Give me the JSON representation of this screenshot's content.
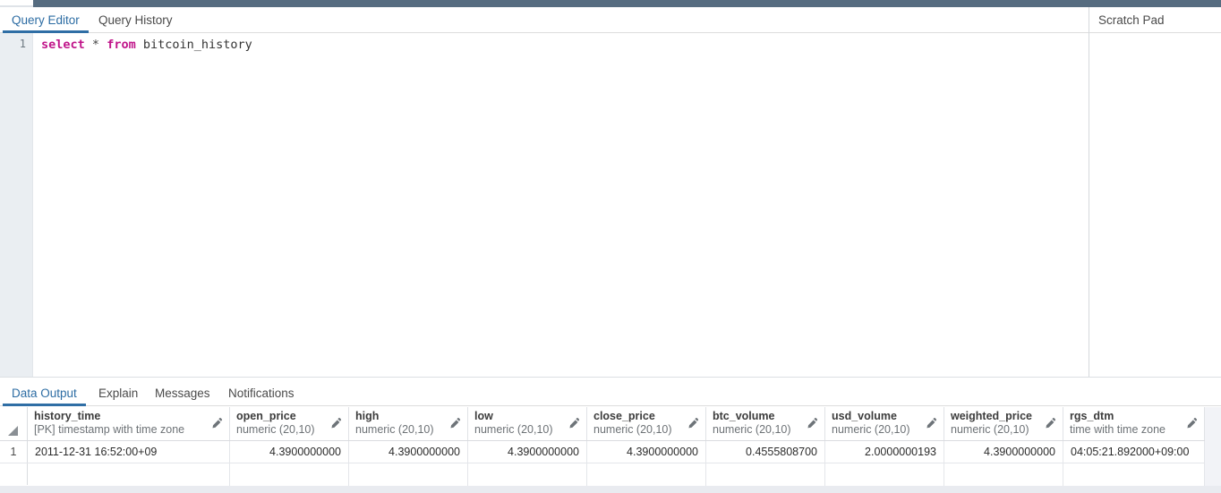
{
  "window": {
    "accent_color": "#2f6ea5",
    "top_bar_color": "#566c80"
  },
  "top_tabs": [
    {
      "label": "Query Editor",
      "active": true
    },
    {
      "label": "Query History",
      "active": false
    }
  ],
  "scratch_pad": {
    "title": "Scratch Pad",
    "content": ""
  },
  "editor": {
    "line_number": "1",
    "sql_keyword_1": "select",
    "sql_operator": "*",
    "sql_keyword_2": "from",
    "sql_table": "bitcoin_history"
  },
  "bottom_tabs": [
    {
      "label": "Data Output",
      "active": true
    },
    {
      "label": "Explain",
      "active": false
    },
    {
      "label": "Messages",
      "active": false
    },
    {
      "label": "Notifications",
      "active": false
    }
  ],
  "grid": {
    "columns": [
      {
        "name": "history_time",
        "type": "[PK] timestamp with time zone",
        "align": "txt"
      },
      {
        "name": "open_price",
        "type": "numeric (20,10)",
        "align": "num"
      },
      {
        "name": "high",
        "type": "numeric (20,10)",
        "align": "num"
      },
      {
        "name": "low",
        "type": "numeric (20,10)",
        "align": "num"
      },
      {
        "name": "close_price",
        "type": "numeric (20,10)",
        "align": "num"
      },
      {
        "name": "btc_volume",
        "type": "numeric (20,10)",
        "align": "num"
      },
      {
        "name": "usd_volume",
        "type": "numeric (20,10)",
        "align": "num"
      },
      {
        "name": "weighted_price",
        "type": "numeric (20,10)",
        "align": "num"
      },
      {
        "name": "rgs_dtm",
        "type": "time with time zone",
        "align": "txt"
      }
    ],
    "rows": [
      {
        "index": "1",
        "cells": [
          "2011-12-31 16:52:00+09",
          "4.3900000000",
          "4.3900000000",
          "4.3900000000",
          "4.3900000000",
          "0.4555808700",
          "2.0000000193",
          "4.3900000000",
          "04:05:21.892000+09:00"
        ]
      }
    ]
  }
}
